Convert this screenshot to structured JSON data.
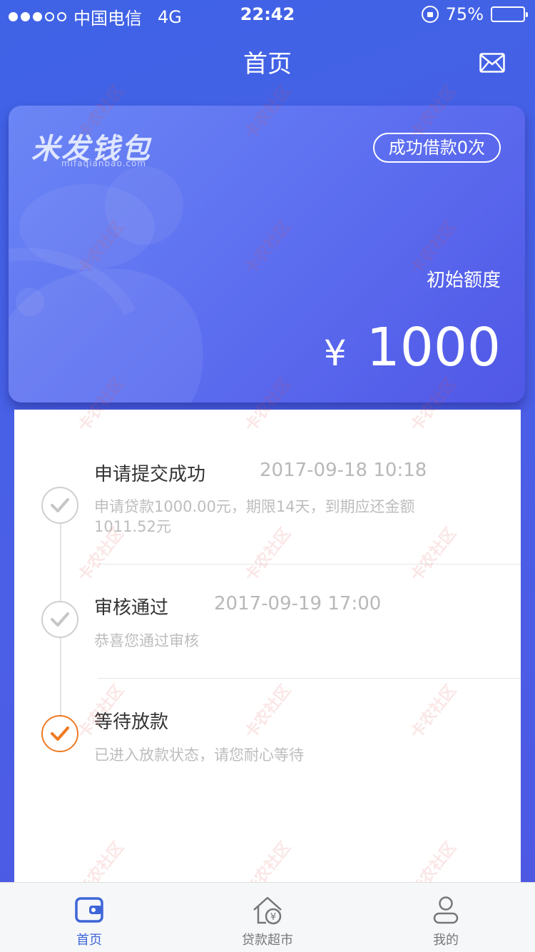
{
  "status_bar": {
    "carrier": "中国电信",
    "network": "4G",
    "time": "22:42",
    "battery": "75%",
    "battery_level": 0.75
  },
  "nav": {
    "title": "首页",
    "icon": "mail-icon"
  },
  "card": {
    "brand_logo": "米发钱包",
    "brand_domain": "mifaqianbao.com",
    "loans_badge": "成功借款0次",
    "quota_label": "初始额度",
    "currency": "¥",
    "amount": "1000"
  },
  "timeline": [
    {
      "title": "申请提交成功",
      "time": "2017-09-18 10:18",
      "desc": "申请贷款1000.00元，期限14天，到期应还金额1011.52元",
      "status": "done"
    },
    {
      "title": "审核通过",
      "time": "2017-09-19 17:00",
      "desc": "恭喜您通过审核",
      "status": "done"
    },
    {
      "title": "等待放款",
      "time": "",
      "desc": "已进入放款状态，请您耐心等待",
      "status": "current"
    }
  ],
  "tabs": [
    {
      "label": "首页",
      "icon": "wallet-icon",
      "active": true
    },
    {
      "label": "贷款超市",
      "icon": "house-yen-icon",
      "active": false
    },
    {
      "label": "我的",
      "icon": "person-icon",
      "active": false
    }
  ],
  "watermark": "卡农社区",
  "colors": {
    "accent": "#3f66d8",
    "pending": "#f07a22",
    "done": "#cfcfcf"
  }
}
